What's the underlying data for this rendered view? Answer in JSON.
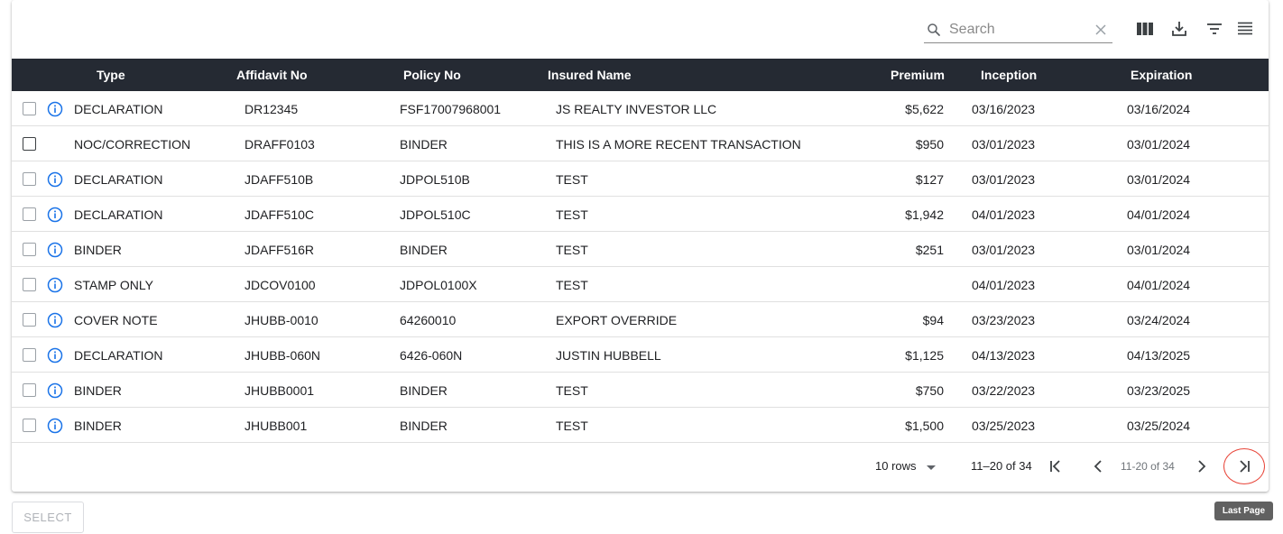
{
  "search": {
    "placeholder": "Search"
  },
  "toolbar_icons": [
    "columns-icon",
    "download-icon",
    "filter-icon",
    "density-icon"
  ],
  "columns": [
    "Type",
    "Affidavit No",
    "Policy No",
    "Insured Name",
    "Premium",
    "Inception",
    "Expiration"
  ],
  "rows": [
    {
      "type": "DECLARATION",
      "affidavit": "DR12345",
      "policy": "FSF17007968001",
      "insured": "JS REALTY INVESTOR LLC",
      "premium": "$5,622",
      "inception": "03/16/2023",
      "expiration": "03/16/2024"
    },
    {
      "type": "NOC/CORRECTION",
      "affidavit": "DRAFF0103",
      "policy": "BINDER",
      "insured": "THIS IS A MORE RECENT TRANSACTION",
      "premium": "$950",
      "inception": "03/01/2023",
      "expiration": "03/01/2024"
    },
    {
      "type": "DECLARATION",
      "affidavit": "JDAFF510B",
      "policy": "JDPOL510B",
      "insured": "TEST",
      "premium": "$127",
      "inception": "03/01/2023",
      "expiration": "03/01/2024"
    },
    {
      "type": "DECLARATION",
      "affidavit": "JDAFF510C",
      "policy": "JDPOL510C",
      "insured": "TEST",
      "premium": "$1,942",
      "inception": "04/01/2023",
      "expiration": "04/01/2024"
    },
    {
      "type": "BINDER",
      "affidavit": "JDAFF516R",
      "policy": "BINDER",
      "insured": "TEST",
      "premium": "$251",
      "inception": "03/01/2023",
      "expiration": "03/01/2024"
    },
    {
      "type": "STAMP ONLY",
      "affidavit": "JDCOV0100",
      "policy": "JDPOL0100X",
      "insured": "TEST",
      "premium": "",
      "inception": "04/01/2023",
      "expiration": "04/01/2024"
    },
    {
      "type": "COVER NOTE",
      "affidavit": "JHUBB-0010",
      "policy": "64260010",
      "insured": "EXPORT OVERRIDE",
      "premium": "$94",
      "inception": "03/23/2023",
      "expiration": "03/24/2024"
    },
    {
      "type": "DECLARATION",
      "affidavit": "JHUBB-060N",
      "policy": "6426-060N",
      "insured": "JUSTIN HUBBELL",
      "premium": "$1,125",
      "inception": "04/13/2023",
      "expiration": "04/13/2025"
    },
    {
      "type": "BINDER",
      "affidavit": "JHUBB0001",
      "policy": "BINDER",
      "insured": "TEST",
      "premium": "$750",
      "inception": "03/22/2023",
      "expiration": "03/23/2025"
    },
    {
      "type": "BINDER",
      "affidavit": "JHUBB001",
      "policy": "BINDER",
      "insured": "TEST",
      "premium": "$1,500",
      "inception": "03/25/2023",
      "expiration": "03/25/2024"
    }
  ],
  "pagination": {
    "rows_per_page": "10 rows",
    "range": "11–20 of 34",
    "range_small": "11-20 of 34"
  },
  "select_button": "SELECT",
  "tooltip": "Last Page",
  "colors": {
    "header_bg": "#252a33",
    "info_blue": "#1a73e8",
    "highlight_red": "#e8463a"
  }
}
